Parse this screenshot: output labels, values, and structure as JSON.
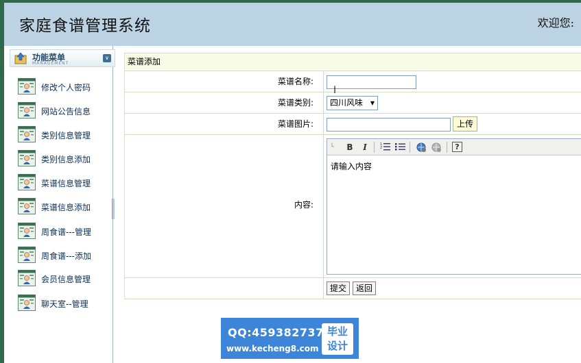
{
  "header": {
    "title": "家庭食谱管理系统",
    "welcome": "欢迎您:"
  },
  "sidebar": {
    "menu_title": "功能菜单",
    "menu_subtitle": "MANAGEMENT",
    "items": [
      {
        "label": "修改个人密码"
      },
      {
        "label": "网站公告信息"
      },
      {
        "label": "类别信息管理"
      },
      {
        "label": "类别信息添加"
      },
      {
        "label": "菜谱信息管理"
      },
      {
        "label": "菜谱信息添加"
      },
      {
        "label": "周食谱---管理"
      },
      {
        "label": "周食谱---添加"
      },
      {
        "label": "会员信息管理"
      },
      {
        "label": "聊天室--管理"
      }
    ]
  },
  "form": {
    "caption": "菜谱添加",
    "name_label": "菜谱名称:",
    "name_value": "",
    "category_label": "菜谱类别:",
    "category_selected": "四川风味",
    "image_label": "菜谱图片:",
    "image_value": "",
    "upload_label": "上传",
    "content_label": "内容:",
    "content_placeholder": "请输入内容",
    "submit_label": "提交",
    "back_label": "返回"
  },
  "editor_toolbar": {
    "bold": "B",
    "italic": "I",
    "help": "?"
  },
  "watermark": {
    "qq": "QQ:459382737",
    "site": "www.kecheng8.com",
    "tag_line1": "毕业",
    "tag_line2": "设计"
  },
  "colors": {
    "header_bg": "#bcd3e4",
    "frame_green": "#2f6b4a",
    "form_caption_bg": "#f8fbe6",
    "badge_blue": "#3d85d8"
  }
}
